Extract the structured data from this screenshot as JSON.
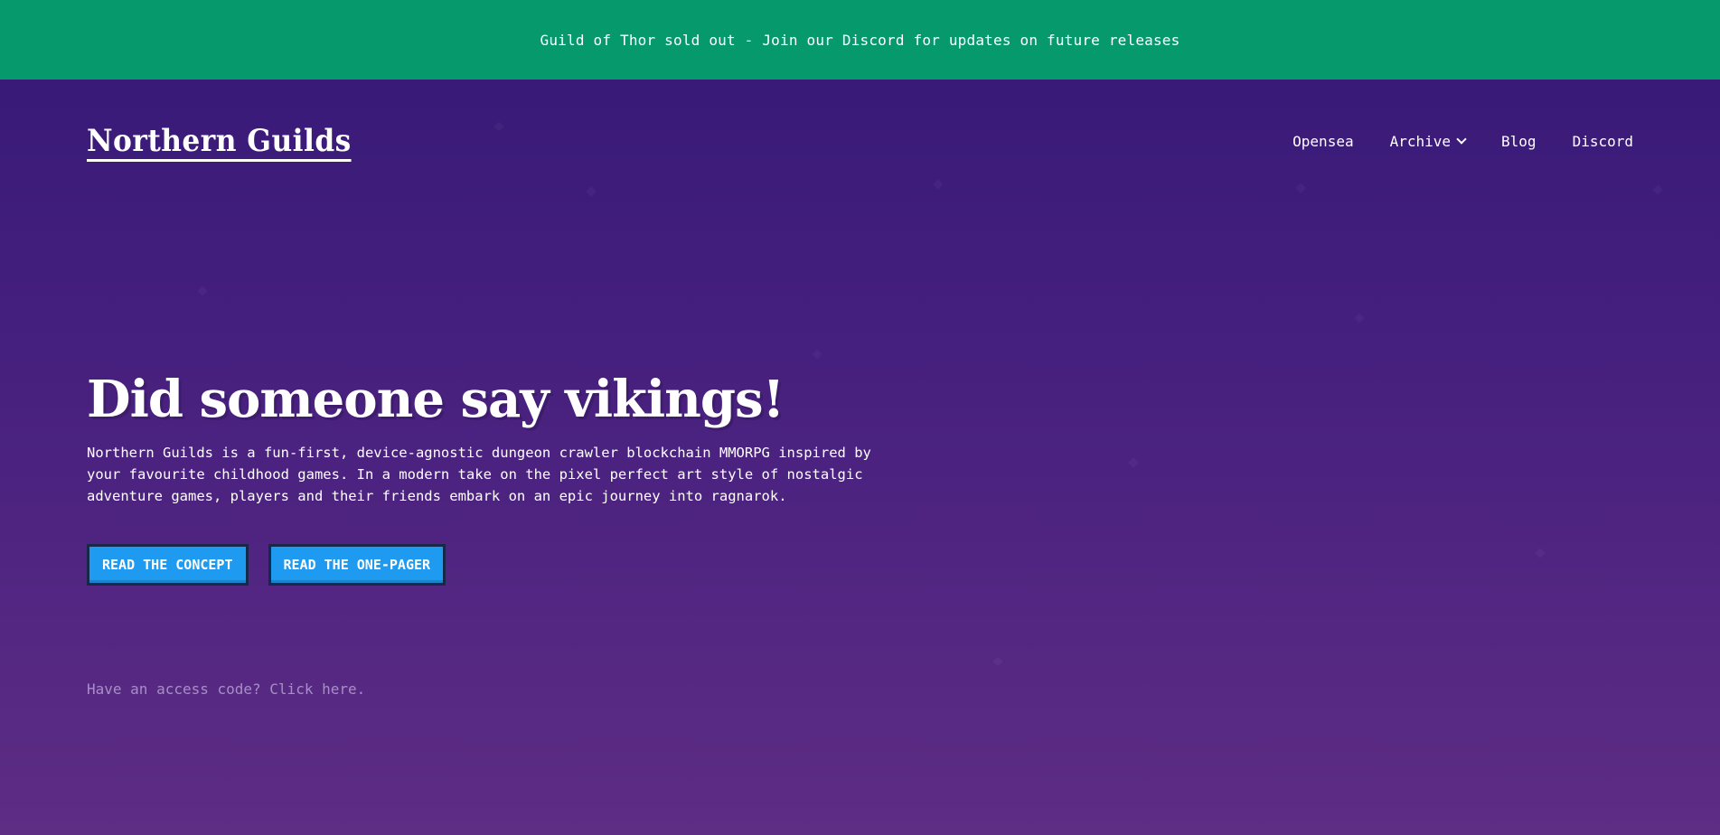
{
  "banner": {
    "text": "Guild of Thor sold out - Join our Discord for updates on future releases"
  },
  "header": {
    "logo": "Northern Guilds",
    "nav": [
      {
        "label": "Opensea"
      },
      {
        "label": "Archive",
        "icon": "chevron-down-icon"
      },
      {
        "label": "Blog"
      },
      {
        "label": "Discord"
      }
    ]
  },
  "hero": {
    "headline": "Did someone say vikings!",
    "description": "Northern Guilds is a fun-first, device-agnostic dungeon crawler blockchain MMORPG inspired by your favourite childhood games. In a modern take on the pixel perfect art style of nostalgic adventure games, players and their friends embark on an epic journey into ragnarok.",
    "buttons": [
      {
        "label": "READ THE CONCEPT"
      },
      {
        "label": "READ THE ONE-PAGER"
      }
    ],
    "access_link": "Have an access code? Click here."
  },
  "colors": {
    "banner": "#05996b",
    "hero_top": "#391a78",
    "hero_bottom": "#5e2d84",
    "button": "#1e9bf0",
    "button_border": "#16294a",
    "muted_link": "#a78fc6"
  }
}
